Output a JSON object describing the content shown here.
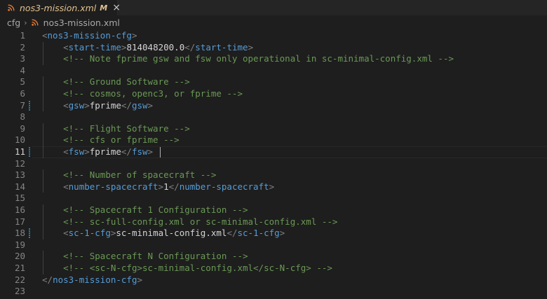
{
  "tab": {
    "name": "nos3-mission.xml",
    "modified": "M",
    "close": "×",
    "icon": "rss-icon"
  },
  "breadcrumb": {
    "folder": "cfg",
    "separator": "›",
    "file": "nos3-mission.xml"
  },
  "editor": {
    "current_line": 11,
    "modified_lines": [
      7,
      11,
      18
    ],
    "lines": [
      {
        "n": "1",
        "indent": 0,
        "parts": [
          [
            "br",
            "<"
          ],
          [
            "tag",
            "nos3-mission-cfg"
          ],
          [
            "br",
            ">"
          ]
        ]
      },
      {
        "n": "2",
        "indent": 1,
        "parts": [
          [
            "br",
            "<"
          ],
          [
            "tag",
            "start-time"
          ],
          [
            "br",
            ">"
          ],
          [
            "txt",
            "814048200.0"
          ],
          [
            "br",
            "</"
          ],
          [
            "tag",
            "start-time"
          ],
          [
            "br",
            ">"
          ]
        ]
      },
      {
        "n": "3",
        "indent": 1,
        "parts": [
          [
            "cmt",
            "<!-- Note fprime gsw and fsw only operational in sc-minimal-config.xml -->"
          ]
        ]
      },
      {
        "n": "4",
        "indent": 0,
        "parts": []
      },
      {
        "n": "5",
        "indent": 1,
        "parts": [
          [
            "cmt",
            "<!-- Ground Software -->"
          ]
        ]
      },
      {
        "n": "6",
        "indent": 1,
        "parts": [
          [
            "cmt",
            "<!-- cosmos, openc3, or fprime -->"
          ]
        ]
      },
      {
        "n": "7",
        "indent": 1,
        "parts": [
          [
            "br",
            "<"
          ],
          [
            "tag",
            "gsw"
          ],
          [
            "br",
            ">"
          ],
          [
            "txt",
            "fprime"
          ],
          [
            "br",
            "</"
          ],
          [
            "tag",
            "gsw"
          ],
          [
            "br",
            ">"
          ]
        ]
      },
      {
        "n": "8",
        "indent": 0,
        "parts": []
      },
      {
        "n": "9",
        "indent": 1,
        "parts": [
          [
            "cmt",
            "<!-- Flight Software -->"
          ]
        ]
      },
      {
        "n": "10",
        "indent": 1,
        "parts": [
          [
            "cmt",
            "<!-- cfs or fprime -->"
          ]
        ]
      },
      {
        "n": "11",
        "indent": 1,
        "parts": [
          [
            "br",
            "<"
          ],
          [
            "tag",
            "fsw"
          ],
          [
            "br",
            ">"
          ],
          [
            "txt",
            "fprime"
          ],
          [
            "br",
            "</"
          ],
          [
            "tag",
            "fsw"
          ],
          [
            "br",
            "> "
          ]
        ]
      },
      {
        "n": "12",
        "indent": 0,
        "parts": []
      },
      {
        "n": "13",
        "indent": 1,
        "parts": [
          [
            "cmt",
            "<!-- Number of spacecraft -->"
          ]
        ]
      },
      {
        "n": "14",
        "indent": 1,
        "parts": [
          [
            "br",
            "<"
          ],
          [
            "tag",
            "number-spacecraft"
          ],
          [
            "br",
            ">"
          ],
          [
            "txt",
            "1"
          ],
          [
            "br",
            "</"
          ],
          [
            "tag",
            "number-spacecraft"
          ],
          [
            "br",
            ">"
          ]
        ]
      },
      {
        "n": "15",
        "indent": 0,
        "parts": []
      },
      {
        "n": "16",
        "indent": 1,
        "parts": [
          [
            "cmt",
            "<!-- Spacecraft 1 Configuration -->"
          ]
        ]
      },
      {
        "n": "17",
        "indent": 1,
        "parts": [
          [
            "cmt",
            "<!-- sc-full-config.xml or sc-minimal-config.xml -->"
          ]
        ]
      },
      {
        "n": "18",
        "indent": 1,
        "parts": [
          [
            "br",
            "<"
          ],
          [
            "tag",
            "sc-1-cfg"
          ],
          [
            "br",
            ">"
          ],
          [
            "txt",
            "sc-minimal-config.xml"
          ],
          [
            "br",
            "</"
          ],
          [
            "tag",
            "sc-1-cfg"
          ],
          [
            "br",
            ">"
          ]
        ]
      },
      {
        "n": "19",
        "indent": 0,
        "parts": []
      },
      {
        "n": "20",
        "indent": 1,
        "parts": [
          [
            "cmt",
            "<!-- Spacecraft N Configuration -->"
          ]
        ]
      },
      {
        "n": "21",
        "indent": 1,
        "parts": [
          [
            "cmt",
            "<!-- <sc-N-cfg>sc-minimal-config.xml</sc-N-cfg> -->"
          ]
        ]
      },
      {
        "n": "22",
        "indent": 0,
        "parts": [
          [
            "br",
            "</"
          ],
          [
            "tag",
            "nos3-mission-cfg"
          ],
          [
            "br",
            ">"
          ]
        ]
      },
      {
        "n": "23",
        "indent": 0,
        "parts": []
      }
    ]
  }
}
